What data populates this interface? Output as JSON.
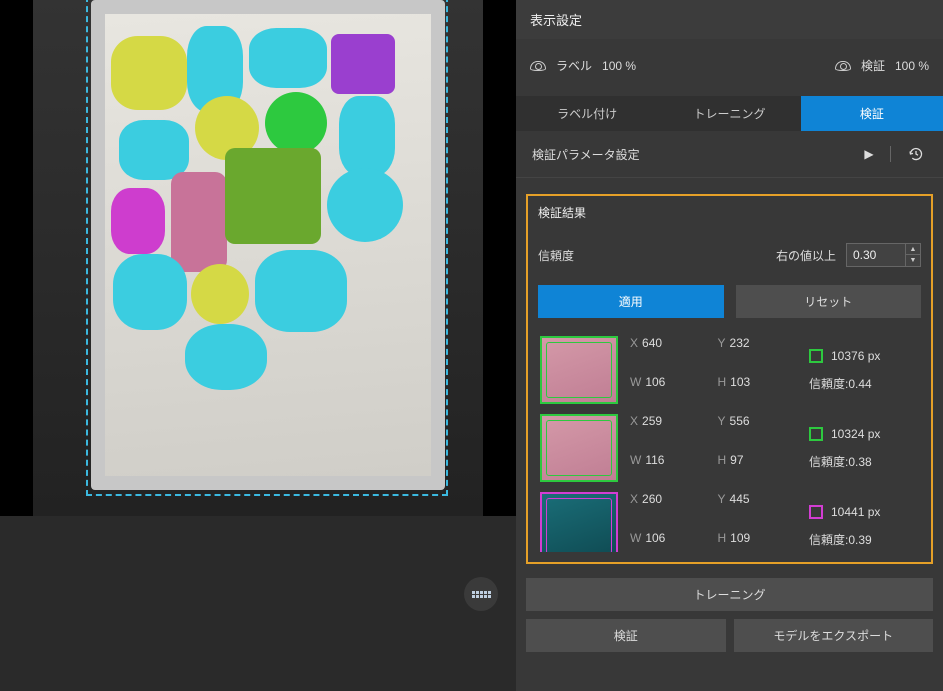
{
  "display_settings": {
    "title": "表示設定",
    "label_name": "ラベル",
    "label_pct": "100 %",
    "verify_name": "検証",
    "verify_pct": "100 %"
  },
  "tabs": {
    "labeling": "ラベル付け",
    "training": "トレーニング",
    "verify": "検証"
  },
  "subsection": {
    "title": "検証パラメータ設定"
  },
  "results": {
    "title": "検証結果",
    "confidence_label": "信頼度",
    "threshold_label": "右の値以上",
    "threshold_value": "0.30",
    "apply_btn": "適用",
    "reset_btn": "リセット",
    "area_unit": "px",
    "conf_prefix": "信頼度:",
    "items": [
      {
        "x": "640",
        "y": "232",
        "w": "106",
        "h": "103",
        "area": "10376",
        "conf": "0.44",
        "color": "green"
      },
      {
        "x": "259",
        "y": "556",
        "w": "116",
        "h": "97",
        "area": "10324",
        "conf": "0.38",
        "color": "green"
      },
      {
        "x": "260",
        "y": "445",
        "w": "106",
        "h": "109",
        "area": "10441",
        "conf": "0.39",
        "color": "magenta"
      }
    ]
  },
  "footer": {
    "training": "トレーニング",
    "verify": "検証",
    "export": "モデルをエクスポート"
  }
}
